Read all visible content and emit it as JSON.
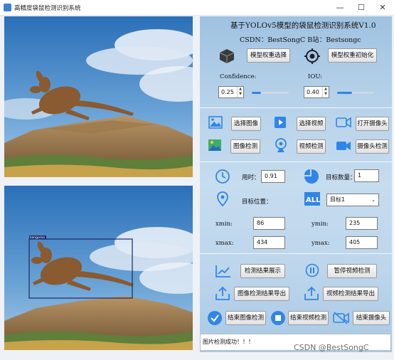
{
  "window": {
    "title": "高精度袋鼠检测识别系统",
    "minimize_glyph": "—",
    "maximize_glyph": "☐",
    "close_glyph": "✕"
  },
  "header": {
    "title": "基于YOLOv5模型的袋鼠检测识别系统V1.0",
    "subtitle": "CSDN：BestSongC   B站：Bestsongc"
  },
  "model": {
    "select_label": "模型权重选择",
    "init_label": "模型权重初始化",
    "confidence_label": "Confidence:",
    "confidence_value": "0.25",
    "confidence_level": 0.25,
    "iou_label": "IOU:",
    "iou_value": "0.40",
    "iou_level": 0.4
  },
  "media": {
    "select_image": "选择图像",
    "select_video": "选择视频",
    "open_camera": "打开摄像头",
    "detect_image": "图像检测",
    "detect_video": "视频检测",
    "detect_camera": "摄像头检测"
  },
  "results": {
    "time_label": "用时：",
    "time_value": "0.91",
    "count_label": "目标数量：",
    "count_value": "1",
    "position_label": "目标位置：",
    "target_selected": "目标1",
    "xmin_label": "xmin:",
    "xmin_value": "86",
    "ymin_label": "ymin:",
    "ymin_value": "235",
    "xmax_label": "xmax:",
    "xmax_value": "434",
    "ymax_label": "ymax:",
    "ymax_value": "405"
  },
  "actions": {
    "show_results": "检测结果展示",
    "pause_video": "暂停视频检测",
    "export_image": "图像检测结果导出",
    "export_video": "视频检测结果导出",
    "end_image": "结束图像检测",
    "end_video": "结束视频检测",
    "end_camera": "结束摄像头"
  },
  "status": {
    "message": "图片检测成功！！！"
  },
  "detection": {
    "label": "kangaroo"
  },
  "watermark": "CSDN @BestSongC",
  "colors": {
    "accent": "#2f86e8",
    "box": "#1a2a66"
  }
}
